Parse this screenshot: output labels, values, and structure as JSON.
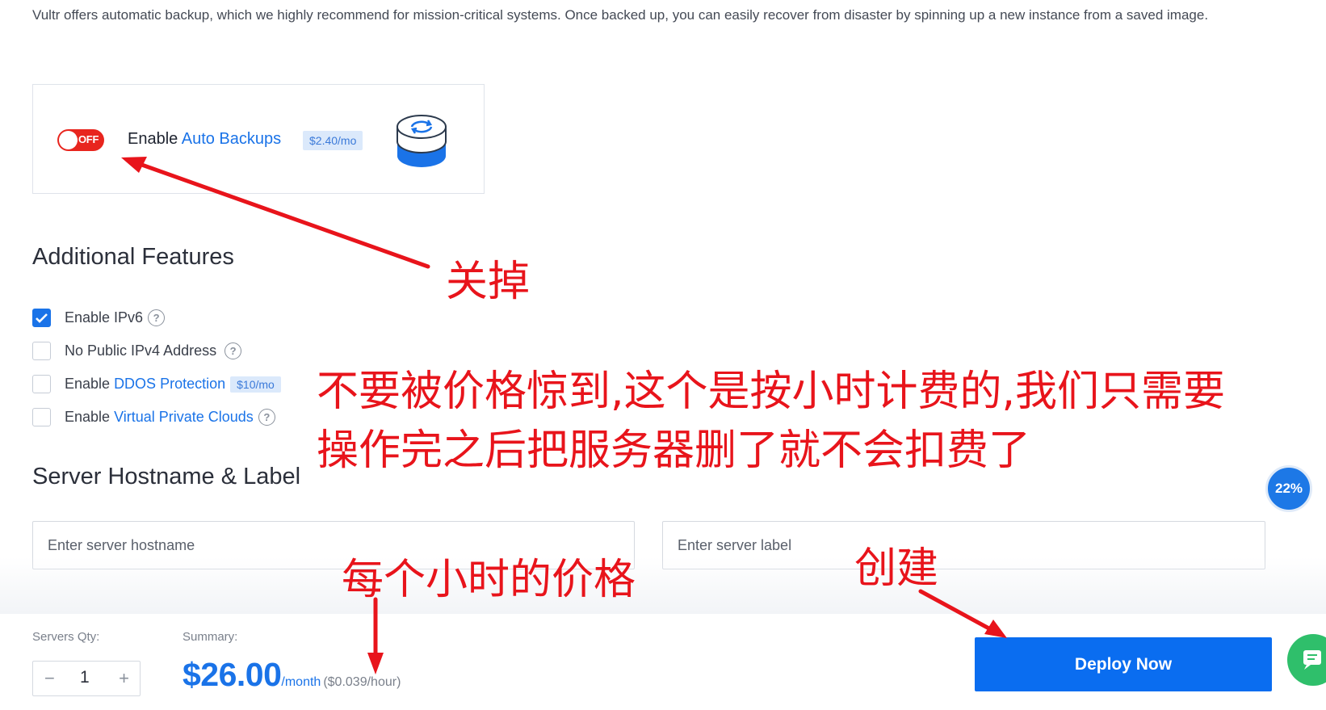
{
  "intro_text": "Vultr offers automatic backup, which we highly recommend for mission-critical systems. Once backed up, you can easily recover from disaster by spinning up a new instance from a saved image.",
  "backup": {
    "toggle_state": "OFF",
    "label_prefix": "Enable ",
    "label_link": "Auto Backups",
    "price": "$2.40/mo",
    "icon": "backup-sync-icon"
  },
  "additional_features": {
    "title": "Additional Features",
    "items": [
      {
        "prefix": "Enable IPv6",
        "link": "",
        "badge": "",
        "help": true,
        "checked": true
      },
      {
        "prefix": "No Public IPv4 Address",
        "link": "",
        "badge": "",
        "help": true,
        "checked": false
      },
      {
        "prefix": "Enable ",
        "link": "DDOS Protection",
        "badge": "$10/mo",
        "help": false,
        "checked": false
      },
      {
        "prefix": "Enable ",
        "link": "Virtual Private Clouds",
        "badge": "",
        "help": true,
        "checked": false
      }
    ]
  },
  "hostname_section": {
    "title": "Server Hostname & Label",
    "hostname_placeholder": "Enter server hostname",
    "label_placeholder": "Enter server label"
  },
  "footer": {
    "qty_label": "Servers Qty:",
    "qty_value": "1",
    "minus": "−",
    "plus": "+",
    "summary_label": "Summary:",
    "price": "$26.00",
    "per_month": "/month",
    "per_hour": "($0.039/hour)",
    "deploy_label": "Deploy Now"
  },
  "progress_badge": "22%",
  "annotations": {
    "close_it": "关掉",
    "note_line1": "不要被价格惊到,这个是按小时计费的,我们只需要",
    "note_line2": "操作完之后把服务器删了就不会扣费了",
    "hourly_price": "每个小时的价格",
    "create": "创建"
  },
  "colors": {
    "accent": "#1a73e8",
    "toggle_off": "#e8251e",
    "annotation": "#e8141b",
    "chat": "#2fbf6b"
  }
}
